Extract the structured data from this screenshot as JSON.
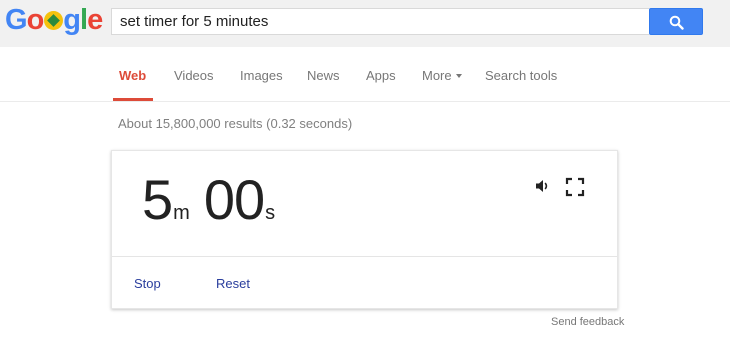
{
  "logo": {
    "text_before": "Go",
    "text_after": "gle"
  },
  "search": {
    "query": "set timer for 5 minutes"
  },
  "tabs": [
    {
      "label": "Web",
      "active": true
    },
    {
      "label": "Videos"
    },
    {
      "label": "Images"
    },
    {
      "label": "News"
    },
    {
      "label": "Apps"
    },
    {
      "label": "More"
    },
    {
      "label": "Search tools"
    }
  ],
  "results_stats": "About 15,800,000 results (0.32 seconds)",
  "timer": {
    "minutes": "5",
    "minutes_unit": "m",
    "seconds": "00",
    "seconds_unit": "s",
    "stop_label": "Stop",
    "reset_label": "Reset"
  },
  "feedback_label": "Send feedback",
  "colors": {
    "accent": "#dd4b39",
    "search_button": "#4285f4",
    "link": "#2a3e9d"
  },
  "icons": {
    "search": "magnifier-icon",
    "sound": "speaker-icon",
    "fullscreen": "fullscreen-icon"
  }
}
